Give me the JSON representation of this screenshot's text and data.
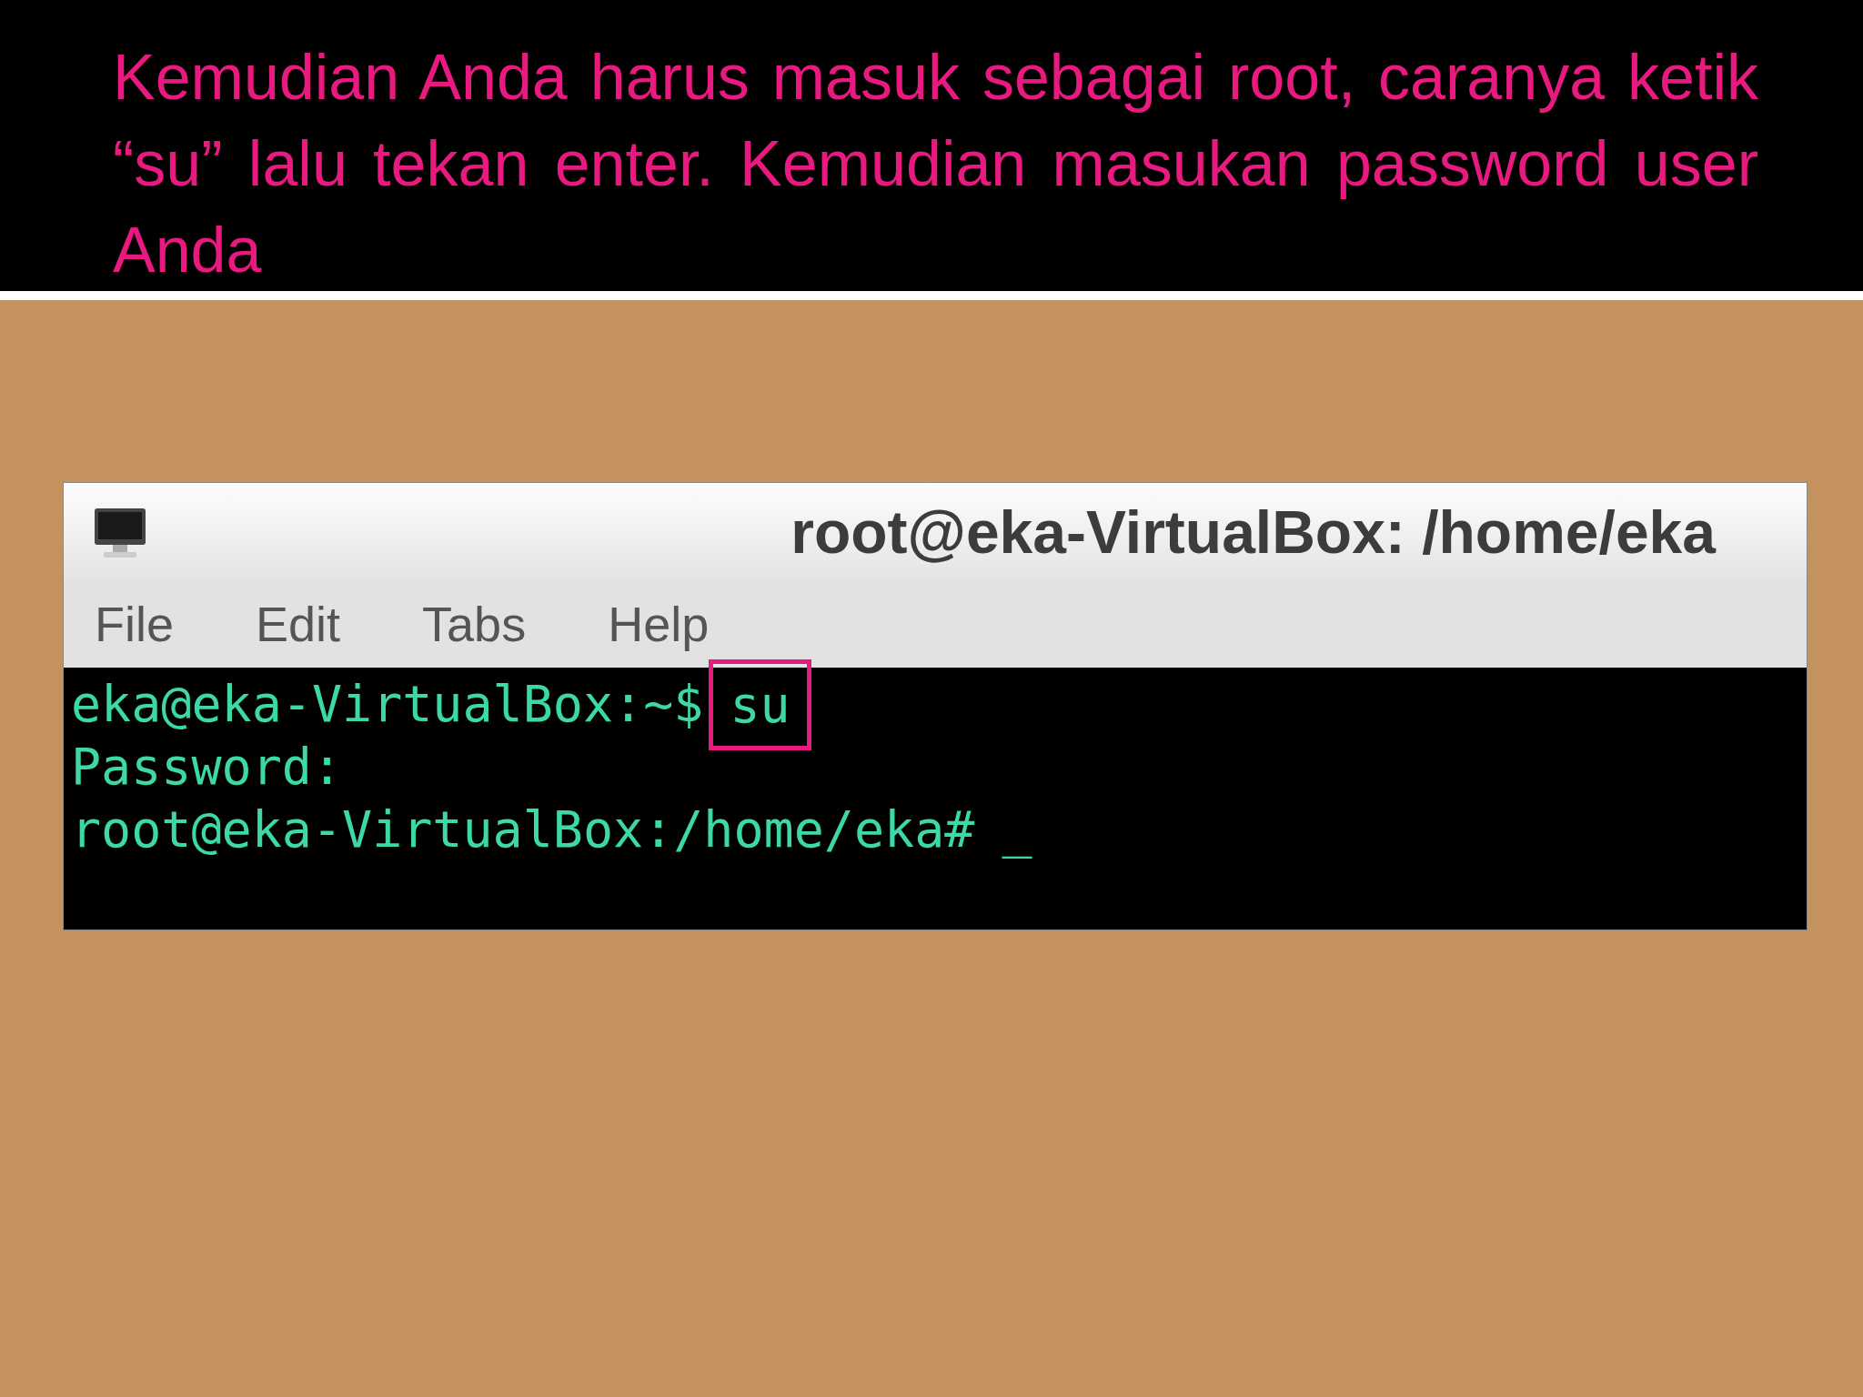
{
  "slide": {
    "caption": "Kemudian Anda harus masuk sebagai root, caranya ketik “su” lalu tekan enter. Kemudian masukan password user Anda"
  },
  "terminal": {
    "title": "root@eka-VirtualBox: /home/eka",
    "menu": [
      "File",
      "Edit",
      "Tabs",
      "Help"
    ],
    "lines": [
      {
        "kind": "command",
        "prompt": "eka@eka-VirtualBox:~$",
        "command": "su"
      },
      {
        "kind": "output",
        "text": "Password:"
      },
      {
        "kind": "prompt",
        "prompt": "root@eka-VirtualBox:/home/eka#",
        "cursor": "_"
      }
    ]
  }
}
